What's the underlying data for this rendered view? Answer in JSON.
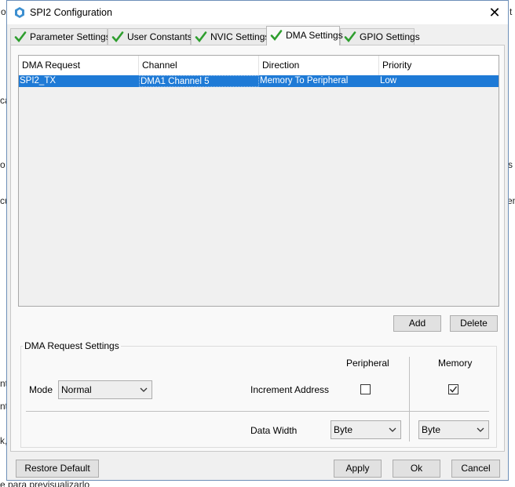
{
  "background": {
    "snippets": [
      "o",
      "t",
      "ca",
      "o",
      "cu",
      "nt",
      "nt",
      "k,",
      "s",
      "en",
      "e para previsualizarlo"
    ]
  },
  "window": {
    "title": "SPI2 Configuration",
    "close_symbol": "✕"
  },
  "tabs": [
    {
      "label": "Parameter Settings",
      "active": false
    },
    {
      "label": "User Constants",
      "active": false
    },
    {
      "label": "NVIC Settings",
      "active": false
    },
    {
      "label": "DMA Settings",
      "active": true
    },
    {
      "label": "GPIO Settings",
      "active": false
    }
  ],
  "dma_table": {
    "headers": [
      "DMA Request",
      "Channel",
      "Direction",
      "Priority"
    ],
    "rows": [
      {
        "request": "SPI2_TX",
        "channel": "DMA1 Channel 5",
        "direction": "Memory To Peripheral",
        "priority": "Low",
        "selected": true
      }
    ]
  },
  "table_buttons": {
    "add": "Add",
    "delete": "Delete"
  },
  "dma_request_settings": {
    "title": "DMA Request Settings",
    "mode_label": "Mode",
    "mode_value": "Normal",
    "peripheral_header": "Peripheral",
    "memory_header": "Memory",
    "increment_address_label": "Increment Address",
    "peripheral_increment": false,
    "memory_increment": true,
    "data_width_label": "Data Width",
    "peripheral_data_width": "Byte",
    "memory_data_width": "Byte"
  },
  "footer": {
    "restore_default": "Restore Default",
    "apply": "Apply",
    "ok": "Ok",
    "cancel": "Cancel"
  },
  "colors": {
    "selection": "#1e7ad6",
    "check_green": "#2e9e2e",
    "window_border": "#6d8fb8"
  }
}
